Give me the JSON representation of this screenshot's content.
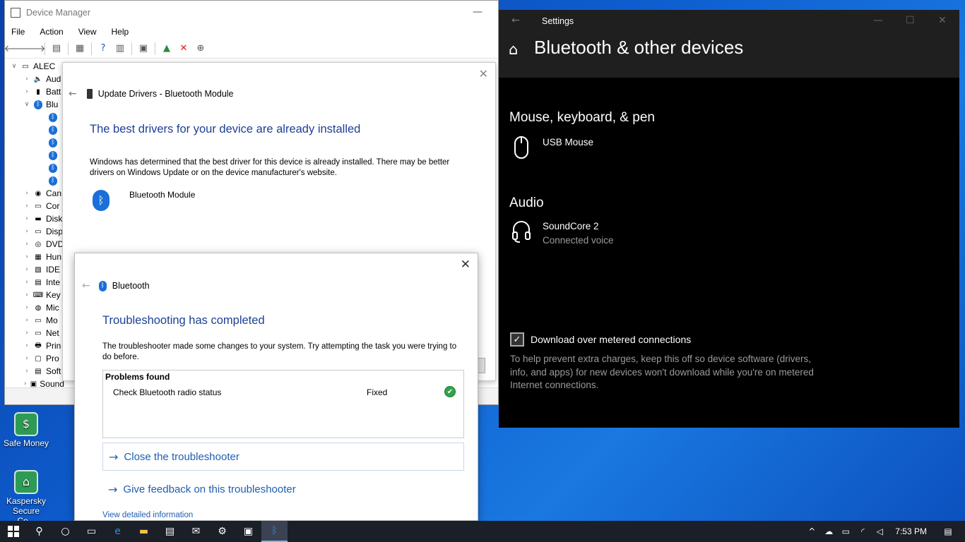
{
  "desktop": {
    "icons": [
      {
        "label": "Safe Money",
        "icon": "safe-money-icon"
      },
      {
        "label": "Kaspersky Secure Co...",
        "icon": "kaspersky-icon"
      }
    ]
  },
  "device_manager": {
    "title": "Device Manager",
    "menu": [
      "File",
      "Action",
      "View",
      "Help"
    ],
    "tree": {
      "root": "ALEC",
      "items": [
        {
          "label": "Aud",
          "expanded": false
        },
        {
          "label": "Batt",
          "expanded": false
        },
        {
          "label": "Blu",
          "expanded": true,
          "children": 6
        },
        {
          "label": "Can",
          "expanded": false
        },
        {
          "label": "Cor",
          "expanded": false
        },
        {
          "label": "Disk",
          "expanded": false
        },
        {
          "label": "Disp",
          "expanded": false
        },
        {
          "label": "DVD",
          "expanded": false
        },
        {
          "label": "Hun",
          "expanded": false
        },
        {
          "label": "IDE",
          "expanded": false
        },
        {
          "label": "Inte",
          "expanded": false
        },
        {
          "label": "Key",
          "expanded": false
        },
        {
          "label": "Mic",
          "expanded": false
        },
        {
          "label": "Mo",
          "expanded": false
        },
        {
          "label": "Net",
          "expanded": false
        },
        {
          "label": "Prin",
          "expanded": false
        },
        {
          "label": "Pro",
          "expanded": false
        },
        {
          "label": "Soft",
          "expanded": false
        },
        {
          "label": "Sound",
          "expanded": false
        }
      ]
    }
  },
  "update_drivers": {
    "header": "Update Drivers - Bluetooth Module",
    "heading": "The best drivers for your device are already installed",
    "description": "Windows has determined that the best driver for this device is already installed. There may be better drivers on Windows Update or on the device manufacturer's website.",
    "device_name": "Bluetooth Module"
  },
  "troubleshooter": {
    "header": "Bluetooth",
    "heading": "Troubleshooting has completed",
    "description": "The troubleshooter made some changes to your system. Try attempting the task you were trying to do before.",
    "problems_header": "Problems found",
    "problems": [
      {
        "name": "Check Bluetooth radio status",
        "status": "Fixed"
      }
    ],
    "close_link": "Close the troubleshooter",
    "feedback_link": "Give feedback on this troubleshooter",
    "detail_link": "View detailed information"
  },
  "settings": {
    "title": "Settings",
    "heading": "Bluetooth & other devices",
    "sections": [
      {
        "title": "Mouse, keyboard, & pen",
        "devices": [
          {
            "name": "USB Mouse",
            "status": "",
            "icon": "mouse-icon"
          }
        ]
      },
      {
        "title": "Audio",
        "devices": [
          {
            "name": "SoundCore 2",
            "status": "Connected voice",
            "icon": "headset-icon"
          }
        ]
      }
    ],
    "metered_label": "Download over metered connections",
    "metered_checked": true,
    "metered_note": "To help prevent extra charges, keep this off so device software (drivers, info, and apps) for new devices won't download while you're on metered Internet connections."
  },
  "taskbar": {
    "time": "7:53 PM",
    "apps": [
      "start-icon",
      "search-icon",
      "cortana-icon",
      "task-view-icon",
      "edge-icon",
      "file-explorer-icon",
      "store-icon",
      "mail-icon",
      "settings-icon",
      "device-manager-icon",
      "bluetooth-icon"
    ],
    "active_app": "bluetooth-icon"
  }
}
